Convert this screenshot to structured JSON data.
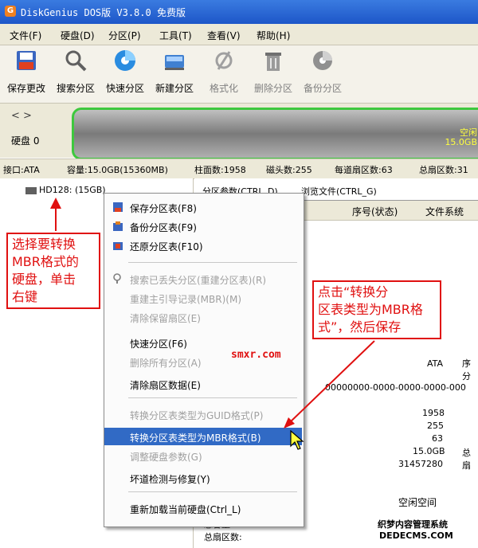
{
  "window": {
    "title": "DiskGenius DOS版 V3.8.0 免费版"
  },
  "menubar": [
    "文件(F)",
    "硬盘(D)",
    "分区(P)",
    "工具(T)",
    "查看(V)",
    "帮助(H)"
  ],
  "toolbar": [
    {
      "label": "保存更改",
      "icon": "save-icon",
      "enabled": true
    },
    {
      "label": "搜索分区",
      "icon": "magnifier-icon",
      "enabled": true
    },
    {
      "label": "快速分区",
      "icon": "quick-partition-icon",
      "enabled": true
    },
    {
      "label": "新建分区",
      "icon": "new-partition-icon",
      "enabled": true
    },
    {
      "label": "格式化",
      "icon": "format-icon",
      "enabled": false
    },
    {
      "label": "删除分区",
      "icon": "trash-icon",
      "enabled": false
    },
    {
      "label": "备份分区",
      "icon": "backup-icon",
      "enabled": false
    }
  ],
  "disk": {
    "nav": "< >",
    "label": "硬盘 0",
    "free_label": "空闲",
    "free_size": "15.0GB"
  },
  "info": {
    "interface": "接口:ATA",
    "capacity": "容量:15.0GB(15360MB)",
    "cylinders": "柱面数:1958",
    "heads": "磁头数:255",
    "sectors_per_track": "每道扇区数:63",
    "total_sectors": "总扇区数:31"
  },
  "tree": {
    "node": "HD128: (15GB)"
  },
  "tabs": [
    "分区参数(CTRL_D)",
    "浏览文件(CTRL_G)"
  ],
  "columns": [
    "序号(状态)",
    "文件系统"
  ],
  "details": {
    "iface_value": "ATA",
    "label_seq": "序",
    "label_part": "分",
    "guid": "00000000-0000-0000-0000-000",
    "cylinders": "1958",
    "heads": "255",
    "sectors": "63",
    "capacity": "15.0GB",
    "capacity_label": "总",
    "total_sectors": "31457280",
    "sector_label": "扇",
    "free_space": "空闲空间",
    "total_capacity_label": "总容量:",
    "total_sector_label": "总扇区数:"
  },
  "context_menu": {
    "items": [
      {
        "label": "保存分区表(F8)",
        "enabled": true,
        "icon": "save-table-icon"
      },
      {
        "label": "备份分区表(F9)",
        "enabled": true,
        "icon": "backup-table-icon"
      },
      {
        "label": "还原分区表(F10)",
        "enabled": true,
        "icon": "restore-table-icon"
      },
      {
        "label": "搜索已丢失分区(重建分区表)(R)",
        "enabled": false,
        "icon": "search-icon"
      },
      {
        "label": "重建主引导记录(MBR)(M)",
        "enabled": false
      },
      {
        "label": "清除保留扇区(E)",
        "enabled": false
      },
      {
        "label": "快速分区(F6)",
        "enabled": true
      },
      {
        "label": "删除所有分区(A)",
        "enabled": false
      },
      {
        "label": "清除扇区数据(E)",
        "enabled": true
      },
      {
        "label": "转换分区表类型为GUID格式(P)",
        "enabled": false
      },
      {
        "label": "转换分区表类型为MBR格式(B)",
        "enabled": true,
        "highlighted": true
      },
      {
        "label": "调整硬盘参数(G)",
        "enabled": false
      },
      {
        "label": "坏道检测与修复(Y)",
        "enabled": true
      },
      {
        "label": "重新加载当前硬盘(Ctrl_L)",
        "enabled": true
      }
    ]
  },
  "annotations": {
    "left_callout": [
      "选择要转换",
      "MBR格式的",
      "硬盘，单击",
      "右键"
    ],
    "right_callout": [
      "点击“转换分",
      "区表类型为MBR格",
      "式”，然后保存"
    ],
    "watermark": "smxr.com",
    "corner_line1": "织梦内容管理系统",
    "corner_line2": "DEDECMS.COM"
  },
  "colors": {
    "accent": "#316ac5",
    "annotation": "#e01010",
    "disk_border": "#3ec83e",
    "free_text": "#ffff40"
  }
}
